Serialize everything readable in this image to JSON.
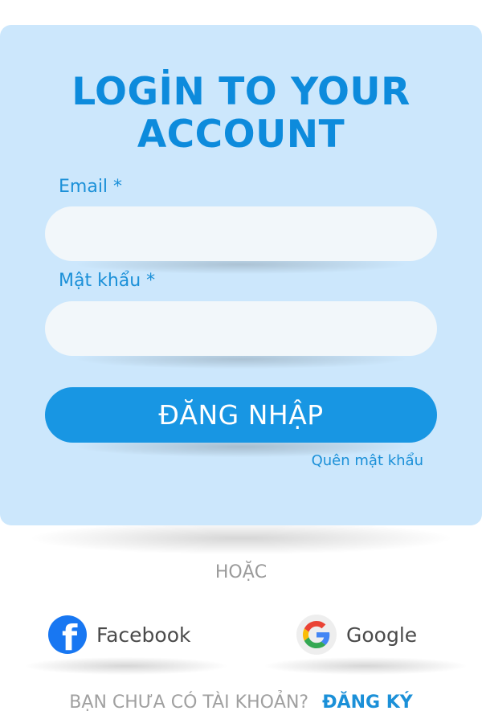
{
  "login": {
    "title_line1": "LOGİN TO YOUR",
    "title_line2": "ACCOUNT",
    "email_label": "Email *",
    "email_value": "",
    "password_label": "Mật khẩu *",
    "password_value": "",
    "submit_label": "ĐĂNG NHẬP",
    "forgot_label": "Quên mật khẩu"
  },
  "divider": {
    "or_label": "HOẶC"
  },
  "social": {
    "facebook_label": "Facebook",
    "google_label": "Google"
  },
  "signup": {
    "question": "BẠN CHƯA CÓ TÀI KHOẢN?",
    "link_label": "ĐĂNG KÝ"
  },
  "colors": {
    "card_bg": "#cce7fc",
    "accent": "#1896e3",
    "title": "#0d8bdc",
    "facebook": "#1877f2"
  },
  "icons": [
    "facebook-icon",
    "google-icon"
  ]
}
